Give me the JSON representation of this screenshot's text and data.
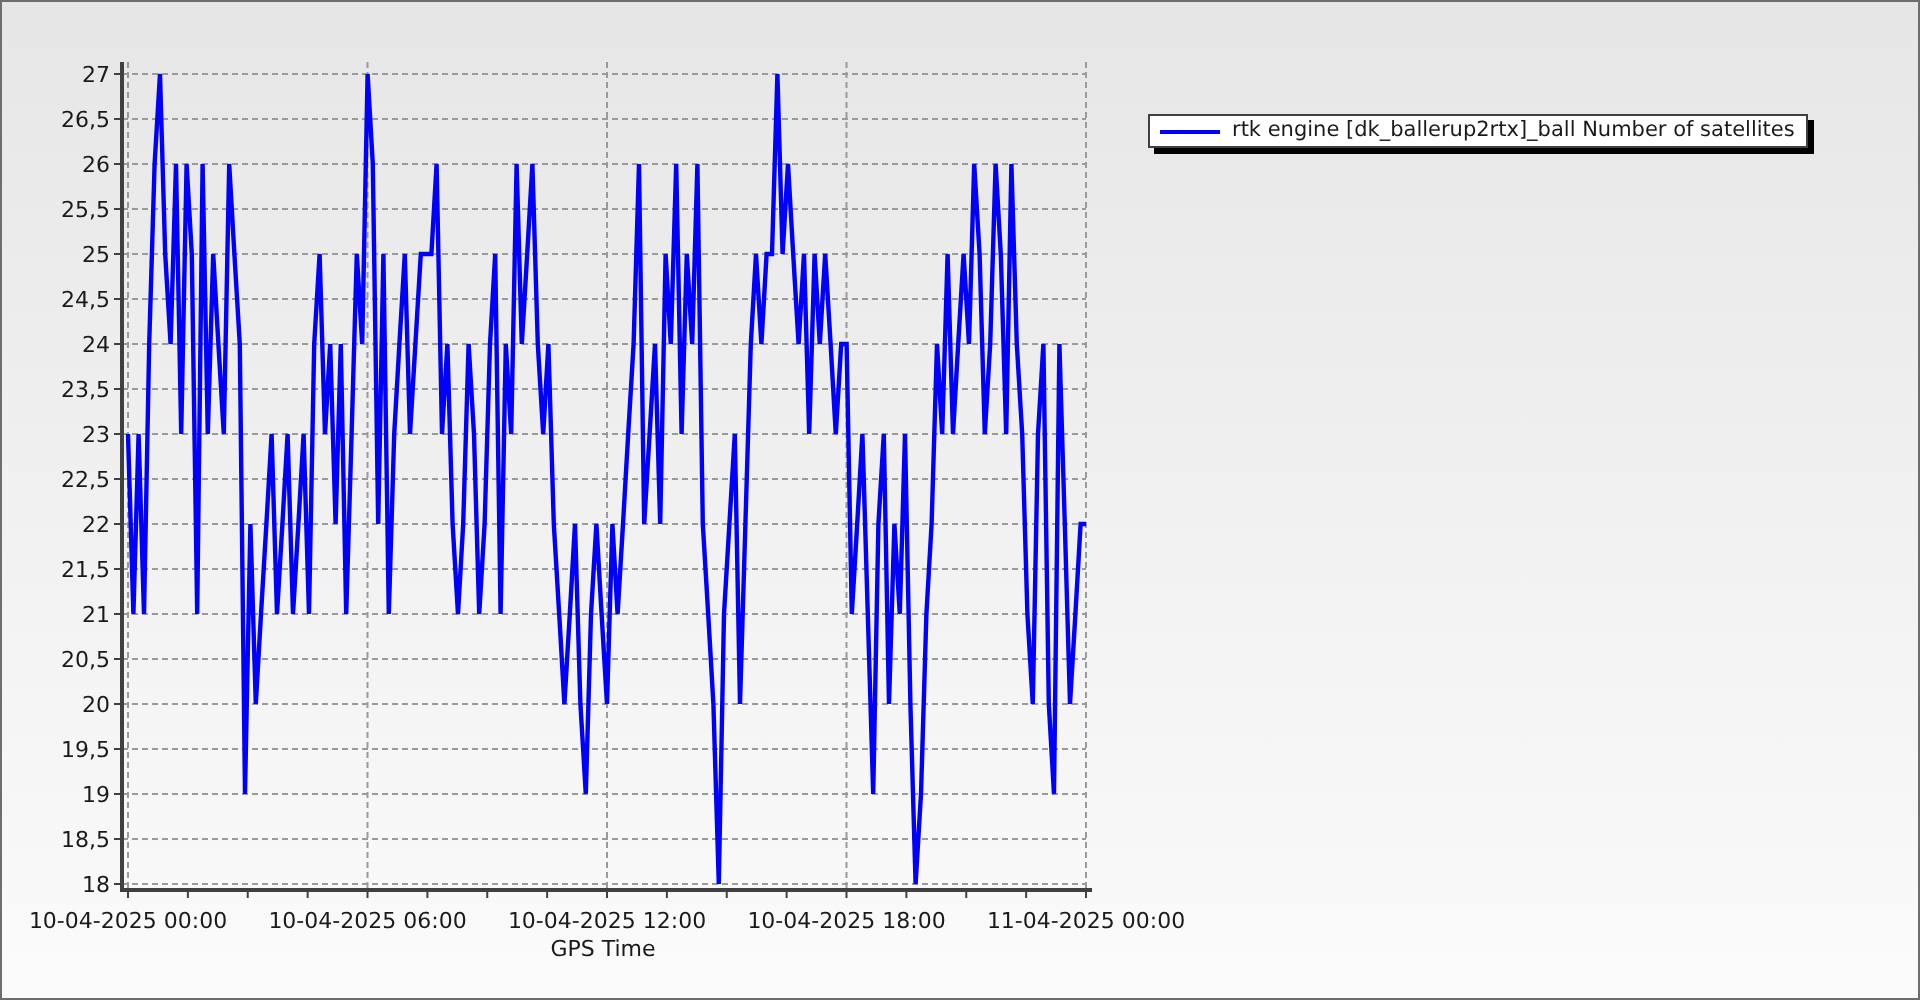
{
  "chart": {
    "chart_data": {
      "type": "line",
      "grid": true,
      "xlabel": "GPS Time",
      "ylim": [
        18,
        27
      ],
      "categories": [
        "10-04-2025 00:00",
        null,
        null,
        null,
        null,
        null,
        null,
        null,
        null,
        null,
        null,
        null,
        null,
        null,
        null,
        null,
        null,
        null,
        null,
        null,
        null,
        null,
        null,
        null,
        null,
        null,
        null,
        null,
        null,
        null,
        null,
        null,
        null,
        null,
        null,
        null,
        null,
        null,
        null,
        null,
        null,
        null,
        null,
        null,
        null,
        "10-04-2025 06:00",
        null,
        null,
        null,
        null,
        null,
        null,
        null,
        null,
        null,
        null,
        null,
        null,
        null,
        null,
        null,
        null,
        null,
        null,
        null,
        null,
        null,
        null,
        null,
        null,
        null,
        null,
        null,
        null,
        null,
        null,
        null,
        null,
        null,
        null,
        null,
        null,
        null,
        null,
        null,
        null,
        null,
        null,
        null,
        null,
        "10-04-2025 12:00",
        null,
        null,
        null,
        null,
        null,
        null,
        null,
        null,
        null,
        null,
        null,
        null,
        null,
        null,
        null,
        null,
        null,
        null,
        null,
        null,
        null,
        null,
        null,
        null,
        null,
        null,
        null,
        null,
        null,
        null,
        null,
        null,
        null,
        null,
        null,
        null,
        null,
        null,
        null,
        null,
        null,
        null,
        null,
        null,
        "10-04-2025 18:00",
        null,
        null,
        null,
        null,
        null,
        null,
        null,
        null,
        null,
        null,
        null,
        null,
        null,
        null,
        null,
        null,
        null,
        null,
        null,
        null,
        null,
        null,
        null,
        null,
        null,
        null,
        null,
        null,
        null,
        null,
        null,
        null,
        null,
        null,
        null,
        null,
        null,
        null,
        null,
        null,
        null,
        null,
        null,
        null,
        "11-04-2025 00:00"
      ],
      "yticks": [
        {
          "value": 18,
          "label": "18"
        },
        {
          "value": 18.5,
          "label": "18,5"
        },
        {
          "value": 19,
          "label": "19"
        },
        {
          "value": 19.5,
          "label": "19,5"
        },
        {
          "value": 20,
          "label": "20"
        },
        {
          "value": 20.5,
          "label": "20,5"
        },
        {
          "value": 21,
          "label": "21"
        },
        {
          "value": 21.5,
          "label": "21,5"
        },
        {
          "value": 22,
          "label": "22"
        },
        {
          "value": 22.5,
          "label": "22,5"
        },
        {
          "value": 23,
          "label": "23"
        },
        {
          "value": 23.5,
          "label": "23,5"
        },
        {
          "value": 24,
          "label": "24"
        },
        {
          "value": 24.5,
          "label": "24,5"
        },
        {
          "value": 25,
          "label": "25"
        },
        {
          "value": 25.5,
          "label": "25,5"
        },
        {
          "value": 26,
          "label": "26"
        },
        {
          "value": 26.5,
          "label": "26,5"
        },
        {
          "value": 27,
          "label": "27"
        }
      ],
      "series": [
        {
          "name": "rtk engine [dk_ballerup2rtx]_ball Number of satellites",
          "color": "#0000ff",
          "values": [
            23,
            21,
            23,
            21,
            24,
            26,
            27,
            25,
            24,
            26,
            23,
            26,
            25,
            21,
            26,
            23,
            25,
            24,
            23,
            26,
            25,
            24,
            19,
            22,
            20,
            21,
            22,
            23,
            21,
            22,
            23,
            21,
            22,
            23,
            21,
            24,
            25,
            23,
            24,
            22,
            24,
            21,
            23,
            25,
            24,
            27,
            26,
            22,
            25,
            21,
            23,
            24,
            25,
            23,
            24,
            25,
            25,
            25,
            26,
            23,
            24,
            22,
            21,
            22,
            24,
            23,
            21,
            22,
            24,
            25,
            21,
            24,
            23,
            26,
            24,
            25,
            26,
            24,
            23,
            24,
            22,
            21,
            20,
            21,
            22,
            20,
            19,
            21,
            22,
            21,
            20,
            22,
            21,
            22,
            23,
            24,
            26,
            22,
            23,
            24,
            22,
            25,
            24,
            26,
            23,
            25,
            24,
            26,
            22,
            21,
            20,
            18,
            21,
            22,
            23,
            20,
            22,
            24,
            25,
            24,
            25,
            25,
            27,
            25,
            26,
            25,
            24,
            25,
            23,
            25,
            24,
            25,
            24,
            23,
            24,
            24,
            21,
            22,
            23,
            21,
            19,
            22,
            23,
            20,
            22,
            21,
            23,
            20,
            18,
            19,
            21,
            22,
            24,
            23,
            25,
            23,
            24,
            25,
            24,
            26,
            25,
            23,
            24,
            26,
            25,
            23,
            26,
            24,
            23,
            21,
            20,
            23,
            24,
            20,
            19,
            24,
            22,
            20,
            21,
            22,
            22
          ]
        }
      ]
    }
  }
}
